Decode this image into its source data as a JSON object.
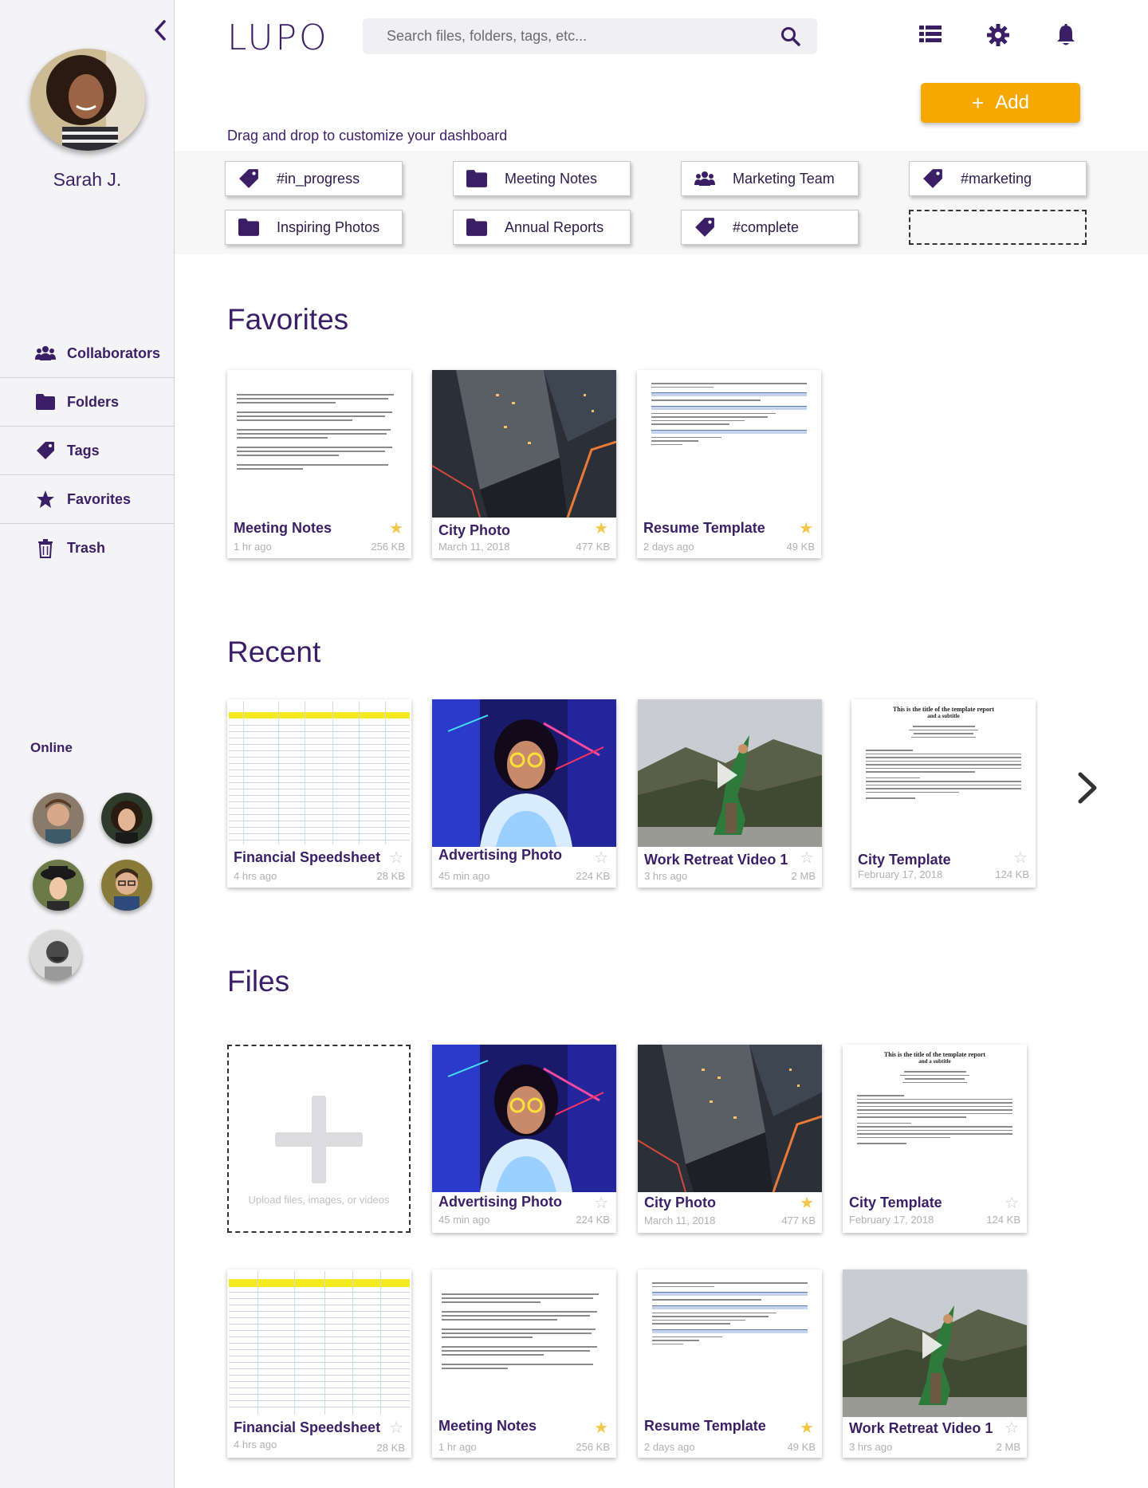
{
  "app": {
    "logo": "LUPO"
  },
  "search": {
    "placeholder": "Search files, folders, tags, etc..."
  },
  "header": {
    "add_label": "Add"
  },
  "user": {
    "name": "Sarah J."
  },
  "sidebar": {
    "items": [
      {
        "label": "Collaborators",
        "icon": "users-icon"
      },
      {
        "label": "Folders",
        "icon": "folder-icon"
      },
      {
        "label": "Tags",
        "icon": "tag-icon"
      },
      {
        "label": "Favorites",
        "icon": "star-icon"
      },
      {
        "label": "Trash",
        "icon": "trash-icon"
      }
    ],
    "online_label": "Online"
  },
  "dashboard": {
    "hint": "Drag and drop to customize your dashboard",
    "shortcuts": [
      {
        "label": "#in_progress",
        "icon": "tag-icon"
      },
      {
        "label": "Meeting Notes",
        "icon": "folder-icon"
      },
      {
        "label": "Marketing Team",
        "icon": "users-icon"
      },
      {
        "label": "#marketing",
        "icon": "tag-icon"
      },
      {
        "label": "Inspiring Photos",
        "icon": "folder-icon"
      },
      {
        "label": "Annual Reports",
        "icon": "folder-icon"
      },
      {
        "label": "#complete",
        "icon": "tag-icon"
      }
    ]
  },
  "sections": {
    "favorites": "Favorites",
    "recent": "Recent",
    "files": "Files"
  },
  "favorites": [
    {
      "title": "Meeting Notes",
      "meta": "1 hr ago",
      "size": "256 KB",
      "starred": true
    },
    {
      "title": "City Photo",
      "meta": "March 11, 2018",
      "size": "477 KB",
      "starred": true
    },
    {
      "title": "Resume Template",
      "meta": "2 days ago",
      "size": "49 KB",
      "starred": true
    }
  ],
  "recent": [
    {
      "title": "Financial Speedsheet",
      "meta": "4 hrs ago",
      "size": "28 KB",
      "starred": false
    },
    {
      "title": "Advertising Photo",
      "meta": "45 min ago",
      "size": "224 KB",
      "starred": false
    },
    {
      "title": "Work Retreat Video 1",
      "meta": "3 hrs ago",
      "size": "2 MB",
      "starred": false
    },
    {
      "title": "City Template",
      "meta": "February 17, 2018",
      "size": "124 KB",
      "starred": false
    }
  ],
  "files": {
    "upload_text": "Upload files, images, or videos",
    "items": [
      {
        "title": "Advertising Photo",
        "meta": "45 min ago",
        "size": "224 KB",
        "starred": false
      },
      {
        "title": "City Photo",
        "meta": "March 11, 2018",
        "size": "477 KB",
        "starred": true
      },
      {
        "title": "City Template",
        "meta": "February 17, 2018",
        "size": "124 KB",
        "starred": false
      },
      {
        "title": "Financial Speedsheet",
        "meta": "4 hrs ago",
        "size": "28 KB",
        "starred": false
      },
      {
        "title": "Meeting Notes",
        "meta": "1 hr ago",
        "size": "256 KB",
        "starred": true
      },
      {
        "title": "Resume Template",
        "meta": "2 days ago",
        "size": "49 KB",
        "starred": true
      },
      {
        "title": "Work Retreat Video 1",
        "meta": "3 hrs ago",
        "size": "2 MB",
        "starred": false
      }
    ]
  },
  "report_thumb": {
    "title": "This is the title of the template report",
    "subtitle": "and a subtitle"
  },
  "colors": {
    "accent": "#3a1f66",
    "add_button": "#f6a800",
    "star": "#f2c54b"
  }
}
